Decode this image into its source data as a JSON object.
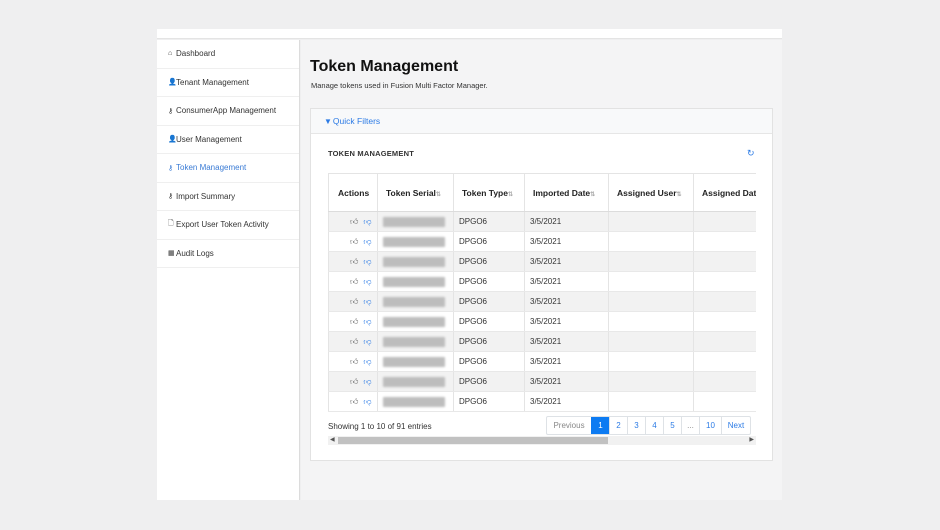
{
  "sidebar": {
    "items": [
      {
        "label": "Dashboard",
        "icon": "home-icon",
        "glyph": "⌂"
      },
      {
        "label": "Tenant Management",
        "icon": "user-icon",
        "glyph": "👤"
      },
      {
        "label": "ConsumerApp Management",
        "icon": "key-icon",
        "glyph": "⚷"
      },
      {
        "label": "User Management",
        "icon": "user-icon",
        "glyph": "👤"
      },
      {
        "label": "Token Management",
        "icon": "key-icon",
        "glyph": "⚷",
        "active": true
      },
      {
        "label": "Import Summary",
        "icon": "key-icon",
        "glyph": "⚷"
      },
      {
        "label": "Export User Token Activity",
        "icon": "file-icon",
        "glyph": "🗋"
      },
      {
        "label": "Audit Logs",
        "icon": "table-icon",
        "glyph": "▦"
      }
    ]
  },
  "page": {
    "title": "Token Management",
    "subtitle": "Manage tokens used in Fusion Multi Factor Manager."
  },
  "filters": {
    "label": "Quick Filters"
  },
  "table": {
    "title": "TOKEN MANAGEMENT",
    "columns": [
      "Actions",
      "Token Serial",
      "Token Type",
      "Imported Date",
      "Assigned User",
      "Assigned Dat"
    ],
    "rows": [
      {
        "type": "DPGO6",
        "imported": "3/5/2021",
        "assigned_user": "",
        "assigned_date": ""
      },
      {
        "type": "DPGO6",
        "imported": "3/5/2021",
        "assigned_user": "",
        "assigned_date": ""
      },
      {
        "type": "DPGO6",
        "imported": "3/5/2021",
        "assigned_user": "",
        "assigned_date": ""
      },
      {
        "type": "DPGO6",
        "imported": "3/5/2021",
        "assigned_user": "",
        "assigned_date": ""
      },
      {
        "type": "DPGO6",
        "imported": "3/5/2021",
        "assigned_user": "",
        "assigned_date": ""
      },
      {
        "type": "DPGO6",
        "imported": "3/5/2021",
        "assigned_user": "",
        "assigned_date": ""
      },
      {
        "type": "DPGO6",
        "imported": "3/5/2021",
        "assigned_user": "",
        "assigned_date": ""
      },
      {
        "type": "DPGO6",
        "imported": "3/5/2021",
        "assigned_user": "",
        "assigned_date": ""
      },
      {
        "type": "DPGO6",
        "imported": "3/5/2021",
        "assigned_user": "",
        "assigned_date": ""
      },
      {
        "type": "DPGO6",
        "imported": "3/5/2021",
        "assigned_user": "",
        "assigned_date": ""
      }
    ],
    "showing": "Showing 1 to 10 of 91 entries"
  },
  "pagination": {
    "items": [
      {
        "label": "Previous",
        "state": "disabled"
      },
      {
        "label": "1",
        "state": "active"
      },
      {
        "label": "2",
        "state": ""
      },
      {
        "label": "3",
        "state": ""
      },
      {
        "label": "4",
        "state": ""
      },
      {
        "label": "5",
        "state": ""
      },
      {
        "label": "...",
        "state": "ell"
      },
      {
        "label": "10",
        "state": ""
      },
      {
        "label": "Next",
        "state": ""
      }
    ]
  },
  "colors": {
    "accent": "#2c7be5",
    "active_page": "#0d7bf2"
  }
}
